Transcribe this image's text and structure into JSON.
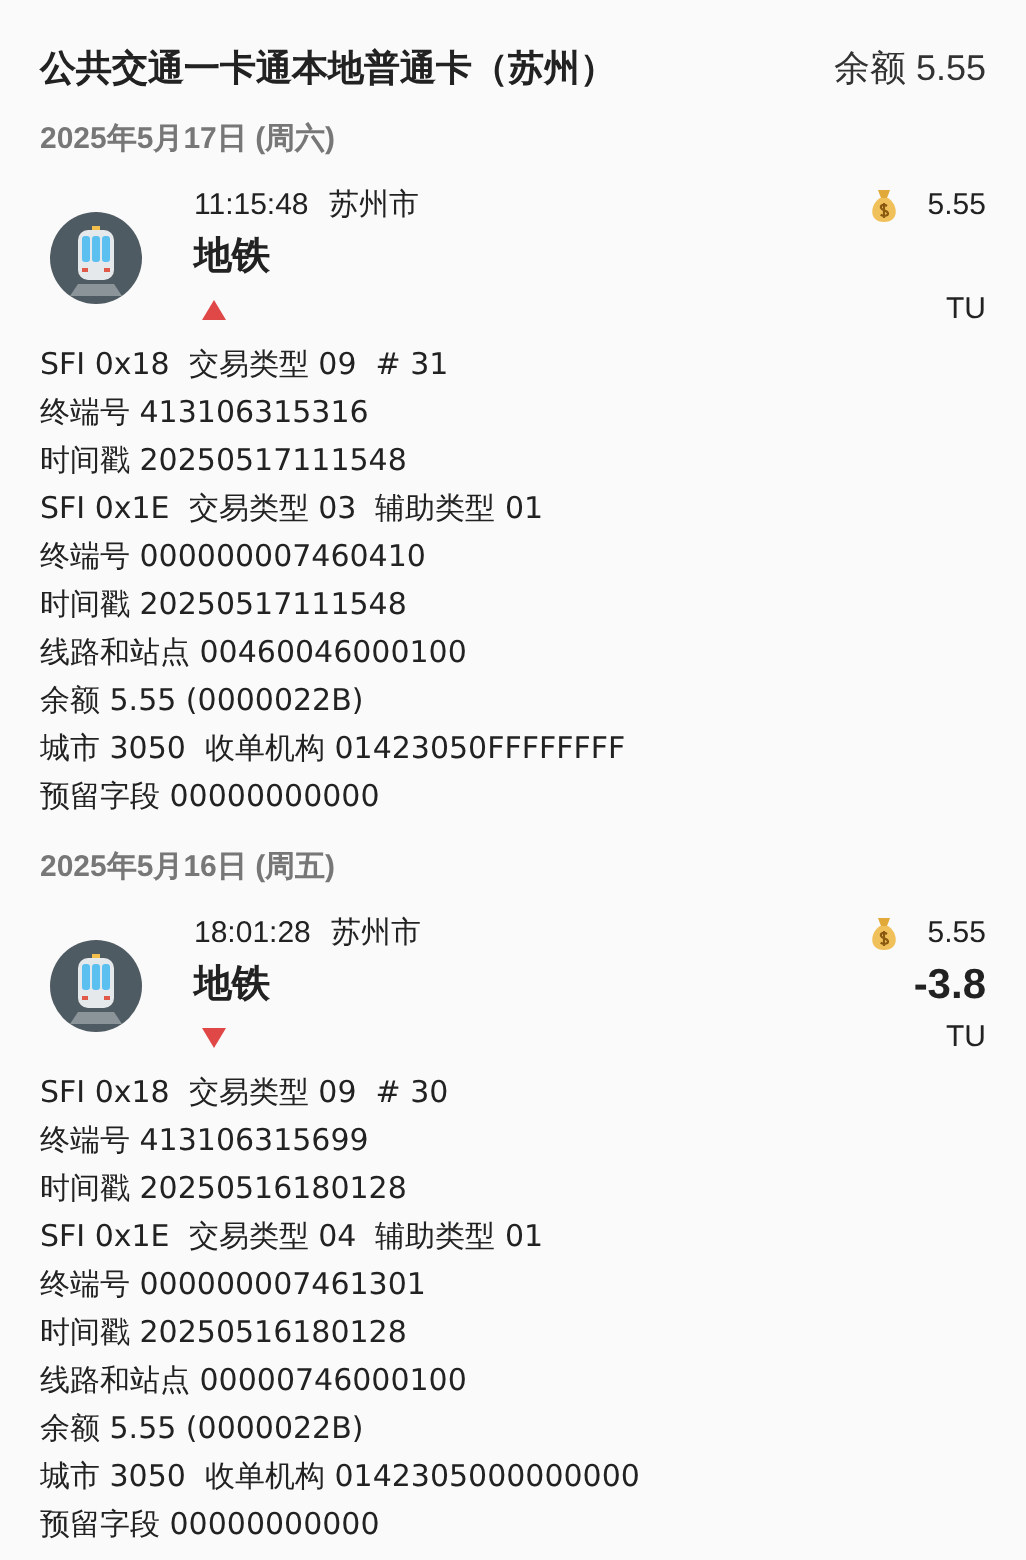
{
  "header": {
    "title": "公共交通一卡通本地普通卡（苏州）",
    "balance": "余额 5.55"
  },
  "days": [
    {
      "date": "2025年5月17日 (周六)",
      "records": [
        {
          "time": "11:15:48",
          "city": "苏州市",
          "type": "地铁",
          "balance": "5.55",
          "increase": true,
          "unit": "TU",
          "details": [
            "SFI 0x18  交易类型 09  # 31",
            "终端号 413106315316",
            "时间戳 20250517111548",
            "SFI 0x1E  交易类型 03  辅助类型 01",
            "终端号 000000007460410",
            "时间戳 20250517111548",
            "线路和站点 00460046000100",
            "余额 5.55 (0000022B)",
            "城市 3050  收单机构 01423050FFFFFFFF",
            "预留字段 00000000000"
          ]
        }
      ]
    },
    {
      "date": "2025年5月16日 (周五)",
      "records": [
        {
          "time": "18:01:28",
          "city": "苏州市",
          "type": "地铁",
          "balance": "5.55",
          "amount": "-3.8",
          "increase": false,
          "unit": "TU",
          "details": [
            "SFI 0x18  交易类型 09  # 30",
            "终端号 413106315699",
            "时间戳 20250516180128",
            "SFI 0x1E  交易类型 04  辅助类型 01",
            "终端号 000000007461301",
            "时间戳 20250516180128",
            "线路和站点 00000746000100",
            "余额 5.55 (0000022B)",
            "城市 3050  收单机构 0142305000000000",
            "预留字段 00000000000"
          ]
        }
      ]
    }
  ]
}
